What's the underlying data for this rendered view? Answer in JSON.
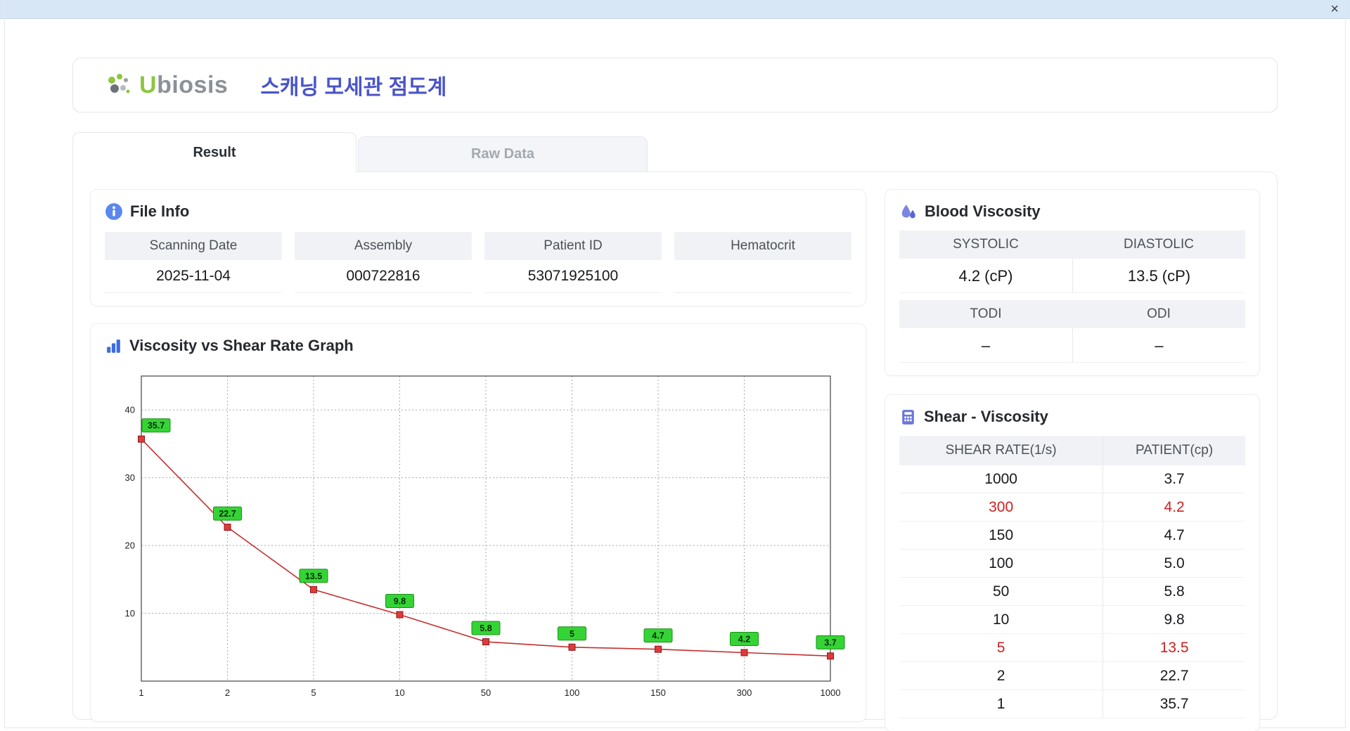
{
  "window": {
    "close_icon": "×"
  },
  "header": {
    "logo_text_accent": "U",
    "logo_text_rest": "biosis",
    "title_korean": "스캐닝 모세관 점도계"
  },
  "tabs": [
    {
      "label": "Result",
      "active": true
    },
    {
      "label": "Raw Data",
      "active": false
    }
  ],
  "file_info": {
    "title": "File Info",
    "fields": [
      {
        "label": "Scanning Date",
        "value": "2025-11-04"
      },
      {
        "label": "Assembly",
        "value": "000722816"
      },
      {
        "label": "Patient ID",
        "value": "53071925100"
      },
      {
        "label": "Hematocrit",
        "value": ""
      }
    ]
  },
  "blood_viscosity": {
    "title": "Blood Viscosity",
    "row1": {
      "col1_label": "SYSTOLIC",
      "col2_label": "DIASTOLIC",
      "col1_value": "4.2 (cP)",
      "col2_value": "13.5 (cP)"
    },
    "row2": {
      "col1_label": "TODI",
      "col2_label": "ODI",
      "col1_value": "–",
      "col2_value": "–"
    }
  },
  "graph_card": {
    "title": "Viscosity vs Shear Rate Graph"
  },
  "shear_table": {
    "title": "Shear - Viscosity",
    "columns": [
      "SHEAR RATE(1/s)",
      "PATIENT(cp)"
    ],
    "rows": [
      {
        "rate": "1000",
        "patient": "3.7",
        "highlight": false
      },
      {
        "rate": "300",
        "patient": "4.2",
        "highlight": true
      },
      {
        "rate": "150",
        "patient": "4.7",
        "highlight": false
      },
      {
        "rate": "100",
        "patient": "5.0",
        "highlight": false
      },
      {
        "rate": "50",
        "patient": "5.8",
        "highlight": false
      },
      {
        "rate": "10",
        "patient": "9.8",
        "highlight": false
      },
      {
        "rate": "5",
        "patient": "13.5",
        "highlight": true
      },
      {
        "rate": "2",
        "patient": "22.7",
        "highlight": false
      },
      {
        "rate": "1",
        "patient": "35.7",
        "highlight": false
      }
    ]
  },
  "chart_data": {
    "type": "line",
    "title": "Viscosity vs Shear Rate Graph",
    "x_categories": [
      "1",
      "2",
      "5",
      "10",
      "50",
      "100",
      "150",
      "300",
      "1000"
    ],
    "values": [
      35.7,
      22.7,
      13.5,
      9.8,
      5.8,
      5.0,
      4.7,
      4.2,
      3.7
    ],
    "point_labels": [
      "35.7",
      "22.7",
      "13.5",
      "9.8",
      "5.8",
      "5",
      "4.7",
      "4.2",
      "3.7"
    ],
    "yticks": [
      10,
      20,
      30,
      40
    ],
    "ylim": [
      0,
      45
    ],
    "x_axis_scale": "category",
    "grid": true,
    "legend": "none",
    "line_color": "#c62f2f",
    "marker_color": "#e03a3a",
    "marker_border": "#8b1a1a",
    "label_bg": "#35d435",
    "label_border": "#1c8f1c"
  },
  "colors": {
    "accent_blue": "#4a54c8",
    "logo_green": "#8dc63f",
    "red_text": "#cf1f1f",
    "titlebar_blue": "#d8e7f6"
  }
}
